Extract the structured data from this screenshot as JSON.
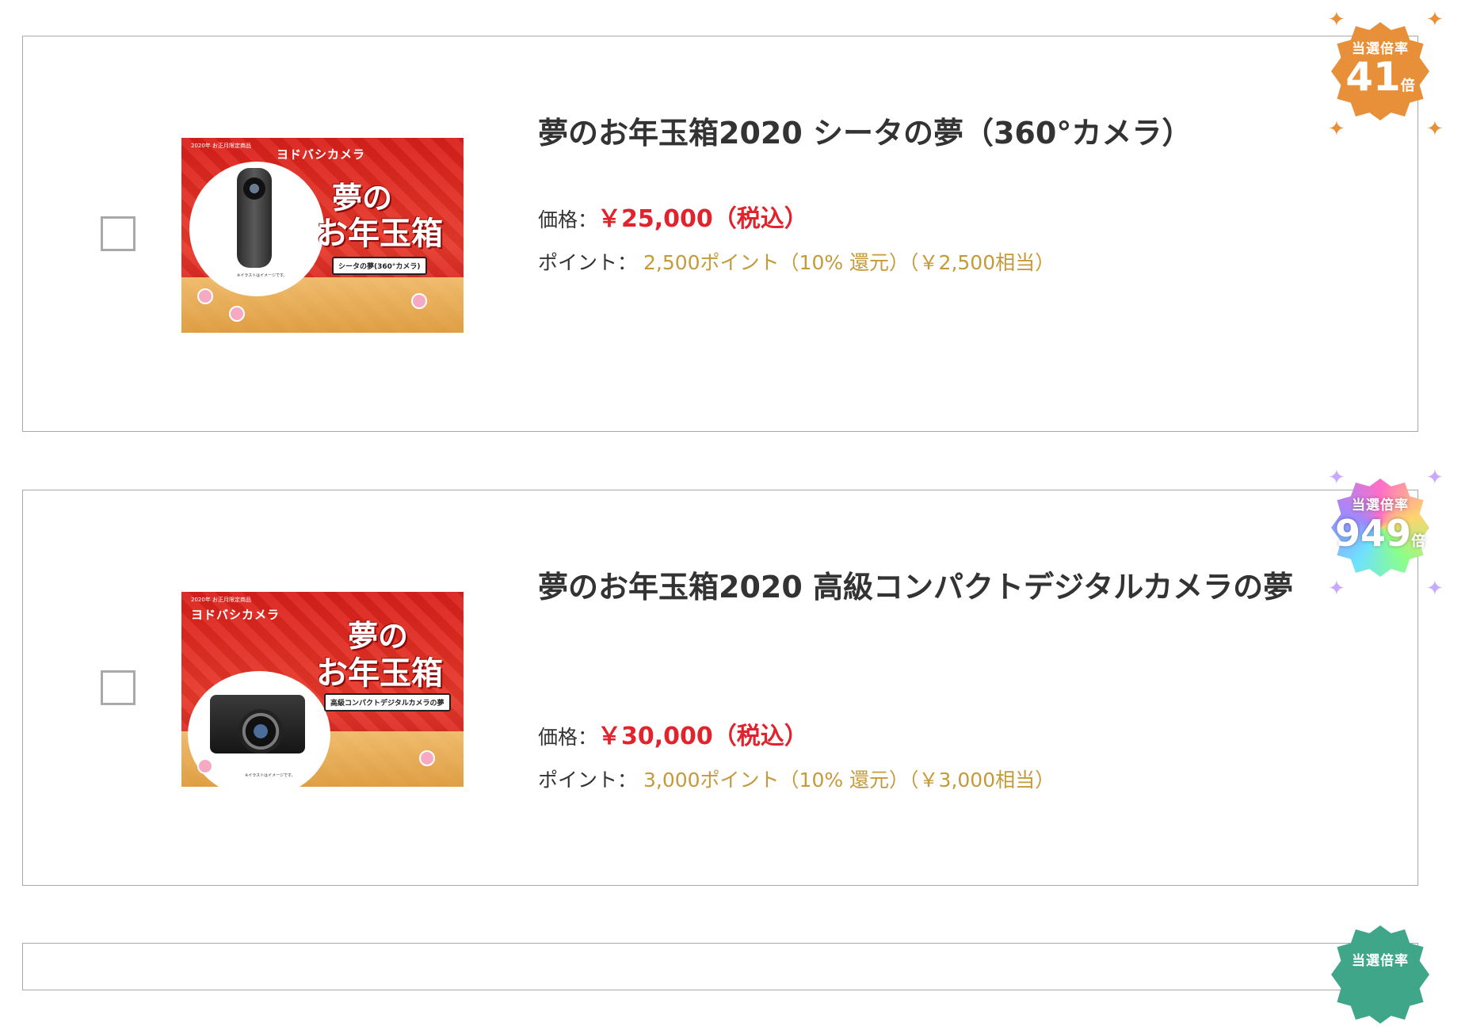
{
  "products": [
    {
      "title": "夢のお年玉箱2020 シータの夢（360°カメラ）",
      "price_label": "価格：",
      "price": "￥25,000（税込）",
      "point_label": "ポイント：",
      "points": "2,500ポイント（10% 還元）（￥2,500相当）",
      "badge": {
        "label": "当選倍率",
        "value": "41",
        "unit": "倍",
        "color": "#e88f3a"
      },
      "thumb": {
        "logo": "ヨドバシカメラ",
        "year": "2020年 お正月限定商品",
        "sticker_top": "夢の",
        "sticker_bottom": "お年玉箱",
        "tag": "シータの夢(360°カメラ)",
        "disclaimer": "※イラストはイメージです。"
      }
    },
    {
      "title": "夢のお年玉箱2020 高級コンパクトデジタルカメラの夢",
      "price_label": "価格：",
      "price": "￥30,000（税込）",
      "point_label": "ポイント：",
      "points": "3,000ポイント（10% 還元）（￥3,000相当）",
      "badge": {
        "label": "当選倍率",
        "value": "949",
        "unit": "倍",
        "color": "rainbow"
      },
      "thumb": {
        "logo": "ヨドバシカメラ",
        "year": "2020年 お正月限定商品",
        "sticker_top": "夢の",
        "sticker_bottom": "お年玉箱",
        "tag": "高級コンパクトデジタルカメラの夢",
        "disclaimer": "※イラストはイメージです。"
      }
    }
  ],
  "partial_badge": {
    "label": "当選倍率",
    "color": "#3fa68a"
  },
  "colors": {
    "price": "#e0232c",
    "points": "#c49a3a",
    "border": "#a8a8a8"
  }
}
